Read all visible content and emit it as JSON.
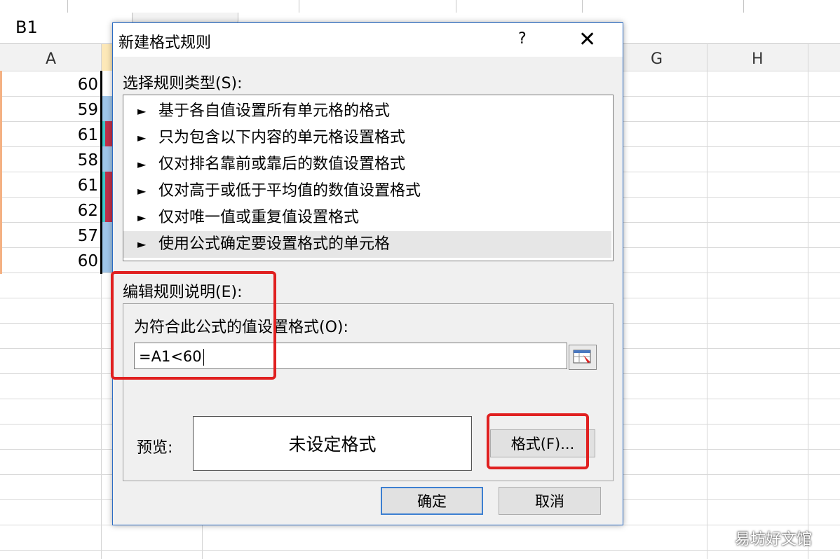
{
  "sheet": {
    "name_box": "B1",
    "columns": [
      "A",
      "G",
      "H"
    ],
    "a_values": [
      "60",
      "59",
      "61",
      "58",
      "61",
      "62",
      "57",
      "60"
    ]
  },
  "dialog": {
    "title": "新建格式规则",
    "help": "?",
    "close": "✕",
    "rule_type_label": "选择规则类型(S):",
    "rule_types": [
      "基于各自值设置所有单元格的格式",
      "只为包含以下内容的单元格设置格式",
      "仅对排名靠前或靠后的数值设置格式",
      "仅对高于或低于平均值的数值设置格式",
      "仅对唯一值或重复值设置格式",
      "使用公式确定要设置格式的单元格"
    ],
    "arrow": "►",
    "edit_label": "编辑规则说明(E):",
    "formula_label": "为符合此公式的值设置格式(O):",
    "formula_value": "=A1<60",
    "preview_label": "预览:",
    "preview_text": "未设定格式",
    "format_button": "格式(F)...",
    "ok_button": "确定",
    "cancel_button": "取消"
  },
  "watermark": "易坊好文馆",
  "colors": {
    "highlight_red": "#e02020",
    "selection_blue": "#3c7fd1"
  }
}
